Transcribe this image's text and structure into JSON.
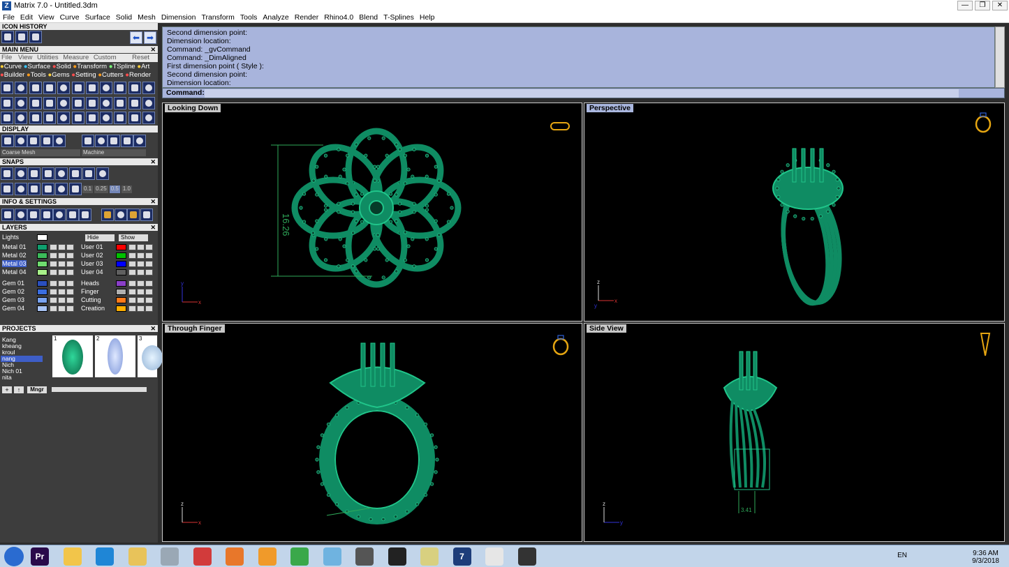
{
  "window": {
    "title": "Matrix 7.0 - Untitled.3dm",
    "app_icon": "Z",
    "min": "—",
    "max": "❐",
    "close": "✕"
  },
  "menu": [
    "File",
    "Edit",
    "View",
    "Curve",
    "Surface",
    "Solid",
    "Mesh",
    "Dimension",
    "Transform",
    "Tools",
    "Analyze",
    "Render",
    "Rhino4.0",
    "Blend",
    "T-Splines",
    "Help"
  ],
  "panels": {
    "icon_history": "ICON HISTORY",
    "main_menu": "MAIN MENU",
    "display": "DISPLAY",
    "snaps": "SNAPS",
    "info_settings": "INFO & SETTINGS",
    "layers": "LAYERS",
    "projects": "PROJECTS"
  },
  "main_menu": {
    "tabs": [
      "File",
      "View",
      "Utilities",
      "Measure",
      "Custom"
    ],
    "reset": "Reset",
    "row1": [
      "Curve",
      "Surface",
      "Solid",
      "Transform",
      "TSpline",
      "Art"
    ],
    "row2": [
      "Builder",
      "Tools",
      "Gems",
      "Setting",
      "Cutters",
      "Render"
    ]
  },
  "display": {
    "mesh": "Coarse Mesh",
    "material": "Machine"
  },
  "snaps": {
    "values": [
      "0.1",
      "0.25",
      "0.5",
      "1.0"
    ]
  },
  "layers": {
    "lights": "Lights",
    "hide": "Hide",
    "show": "Show",
    "left": [
      {
        "name": "Metal 01",
        "color": "#0f9f6e"
      },
      {
        "name": "Metal 02",
        "color": "#3cba5a"
      },
      {
        "name": "Metal 03",
        "color": "#6fdc6f"
      },
      {
        "name": "Metal 04",
        "color": "#a8f08a"
      },
      {
        "name": "Gem 01",
        "color": "#2a4fbf"
      },
      {
        "name": "Gem 02",
        "color": "#3a6de0"
      },
      {
        "name": "Gem 03",
        "color": "#7aa3f0"
      },
      {
        "name": "Gem 04",
        "color": "#a9c4f5"
      }
    ],
    "right": [
      {
        "name": "User 01",
        "color": "#ff0000"
      },
      {
        "name": "User 02",
        "color": "#00c000"
      },
      {
        "name": "User 03",
        "color": "#0000ff"
      },
      {
        "name": "User 04",
        "color": "#606060"
      },
      {
        "name": "Heads",
        "color": "#8a3fc8"
      },
      {
        "name": "Finger",
        "color": "#b0b0b0"
      },
      {
        "name": "Cutting",
        "color": "#ff7a1a"
      },
      {
        "name": "Creation",
        "color": "#ffb000"
      }
    ]
  },
  "projects": {
    "names": [
      "Kang",
      "kheang",
      "kroul",
      "nang",
      "Nich",
      "Nich 01",
      "nita"
    ],
    "selected": "nang",
    "mngr": "Mngr",
    "thumbs": [
      "1",
      "2",
      "3"
    ]
  },
  "command_history": [
    "Second dimension point:",
    "Dimension location:",
    "Command: _gvCommand",
    "Command: _DimAligned",
    "First dimension point ( Style ):",
    "Second dimension point:",
    "Dimension location:"
  ],
  "command_label": "Command:",
  "viewports": {
    "top_left": {
      "label": "Looking Down",
      "dimension": "16.26",
      "axis_x": "x",
      "axis_y": "y"
    },
    "top_right": {
      "label": "Perspective",
      "axis_x": "x",
      "axis_y": "y",
      "axis_z": "z"
    },
    "bottom_left": {
      "label": "Through Finger",
      "axis_x": "x",
      "axis_z": "z"
    },
    "bottom_right": {
      "label": "Side View",
      "dimension": "3.41",
      "axis_y": "y",
      "axis_z": "z"
    }
  },
  "taskbar": {
    "lang": "EN",
    "time": "9:36 AM",
    "date": "9/3/2018",
    "apps": [
      "start",
      "premiere",
      "explorer",
      "ie",
      "folder",
      "calculator",
      "snipping",
      "firefox",
      "media",
      "chrome",
      "notes",
      "tool",
      "zbrush",
      "sticky",
      "matrix",
      "paint",
      "app"
    ]
  },
  "colors": {
    "ring": "#0f8c63",
    "ring_light": "#20c58a",
    "command_bg": "#a8b4dc",
    "dim_line": "#2faa5a"
  }
}
